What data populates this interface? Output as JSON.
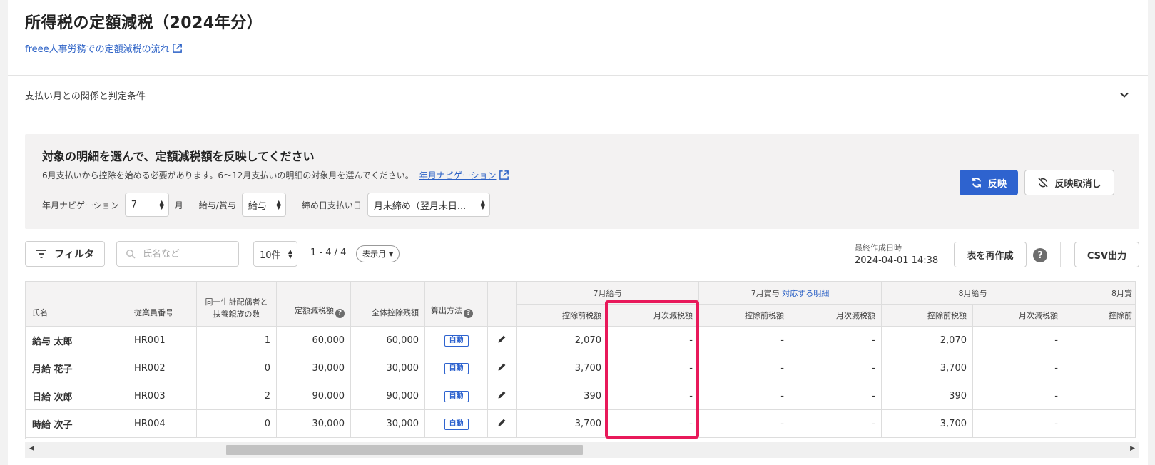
{
  "header": {
    "title": "所得税の定額減税（2024年分）",
    "flow_link": "freee人事労務での定額減税の流れ"
  },
  "accordion": {
    "label": "支払い月との関係と判定条件"
  },
  "panel": {
    "title": "対象の明細を選んで、定額減税額を反映してください",
    "desc": "6月支払いから控除を始める必要があります。6〜12月支払いの明細の対象月を選んでください。",
    "desc_link": "年月ナビゲーション",
    "month_label": "年月ナビゲーション",
    "month_value": "7",
    "month_unit": "月",
    "type_label": "給与/賞与",
    "type_value": "給与",
    "closing_label": "締め日支払い日",
    "closing_value": "月末締め（翌月末日...",
    "apply_label": "反映",
    "cancel_label": "反映取消し"
  },
  "toolbar": {
    "filter_label": "フィルタ",
    "search_placeholder": "氏名など",
    "per_page": "10件",
    "range": "1 - 4 / 4",
    "display_month": "表示月",
    "last_created_label": "最終作成日時",
    "last_created_value": "2024-04-01 14:38",
    "regenerate_label": "表を再作成",
    "help_symbol": "?",
    "csv_label": "CSV出力"
  },
  "table": {
    "headers": {
      "name": "氏名",
      "emp_no": "従業員番号",
      "dependents_line1": "同一生計配偶者と",
      "dependents_line2": "扶養親族の数",
      "fixed_amount": "定額減税額",
      "total_deduction": "全体控除残額",
      "method": "算出方法"
    },
    "groups": [
      {
        "label": "7月給与",
        "link": ""
      },
      {
        "label": "7月賞与",
        "link": "対応する明細"
      },
      {
        "label": "8月給与",
        "link": ""
      },
      {
        "label": "8月賞",
        "link": ""
      }
    ],
    "sub_before": "控除前税額",
    "sub_monthly": "月次減税額",
    "sub_partial": "控除前",
    "rows": [
      {
        "name": "給与 太郎",
        "emp_no": "HR001",
        "dependents": "1",
        "fixed": "60,000",
        "total": "60,000",
        "method": "自動",
        "jul_before": "2,070",
        "jul_monthly": "-",
        "bonus_before": "-",
        "bonus_monthly": "-",
        "aug_before": "2,070",
        "aug_monthly": "-"
      },
      {
        "name": "月給 花子",
        "emp_no": "HR002",
        "dependents": "0",
        "fixed": "30,000",
        "total": "30,000",
        "method": "自動",
        "jul_before": "3,700",
        "jul_monthly": "-",
        "bonus_before": "-",
        "bonus_monthly": "-",
        "aug_before": "3,700",
        "aug_monthly": "-"
      },
      {
        "name": "日給 次郎",
        "emp_no": "HR003",
        "dependents": "2",
        "fixed": "90,000",
        "total": "90,000",
        "method": "自動",
        "jul_before": "390",
        "jul_monthly": "-",
        "bonus_before": "-",
        "bonus_monthly": "-",
        "aug_before": "390",
        "aug_monthly": "-"
      },
      {
        "name": "時給 次子",
        "emp_no": "HR004",
        "dependents": "0",
        "fixed": "30,000",
        "total": "30,000",
        "method": "自動",
        "jul_before": "3,700",
        "jul_monthly": "-",
        "bonus_before": "-",
        "bonus_monthly": "-",
        "aug_before": "3,700",
        "aug_monthly": "-"
      }
    ]
  },
  "icons": {
    "external": "external-link-icon",
    "chevron": "chevron-down-icon",
    "sync": "sync-icon",
    "sync_off": "sync-off-icon",
    "filter": "filter-icon",
    "search": "search-icon",
    "edit": "pencil-icon"
  },
  "colors": {
    "accent": "#2e63cf",
    "highlight": "#e8195a",
    "link": "#2b61c6"
  }
}
